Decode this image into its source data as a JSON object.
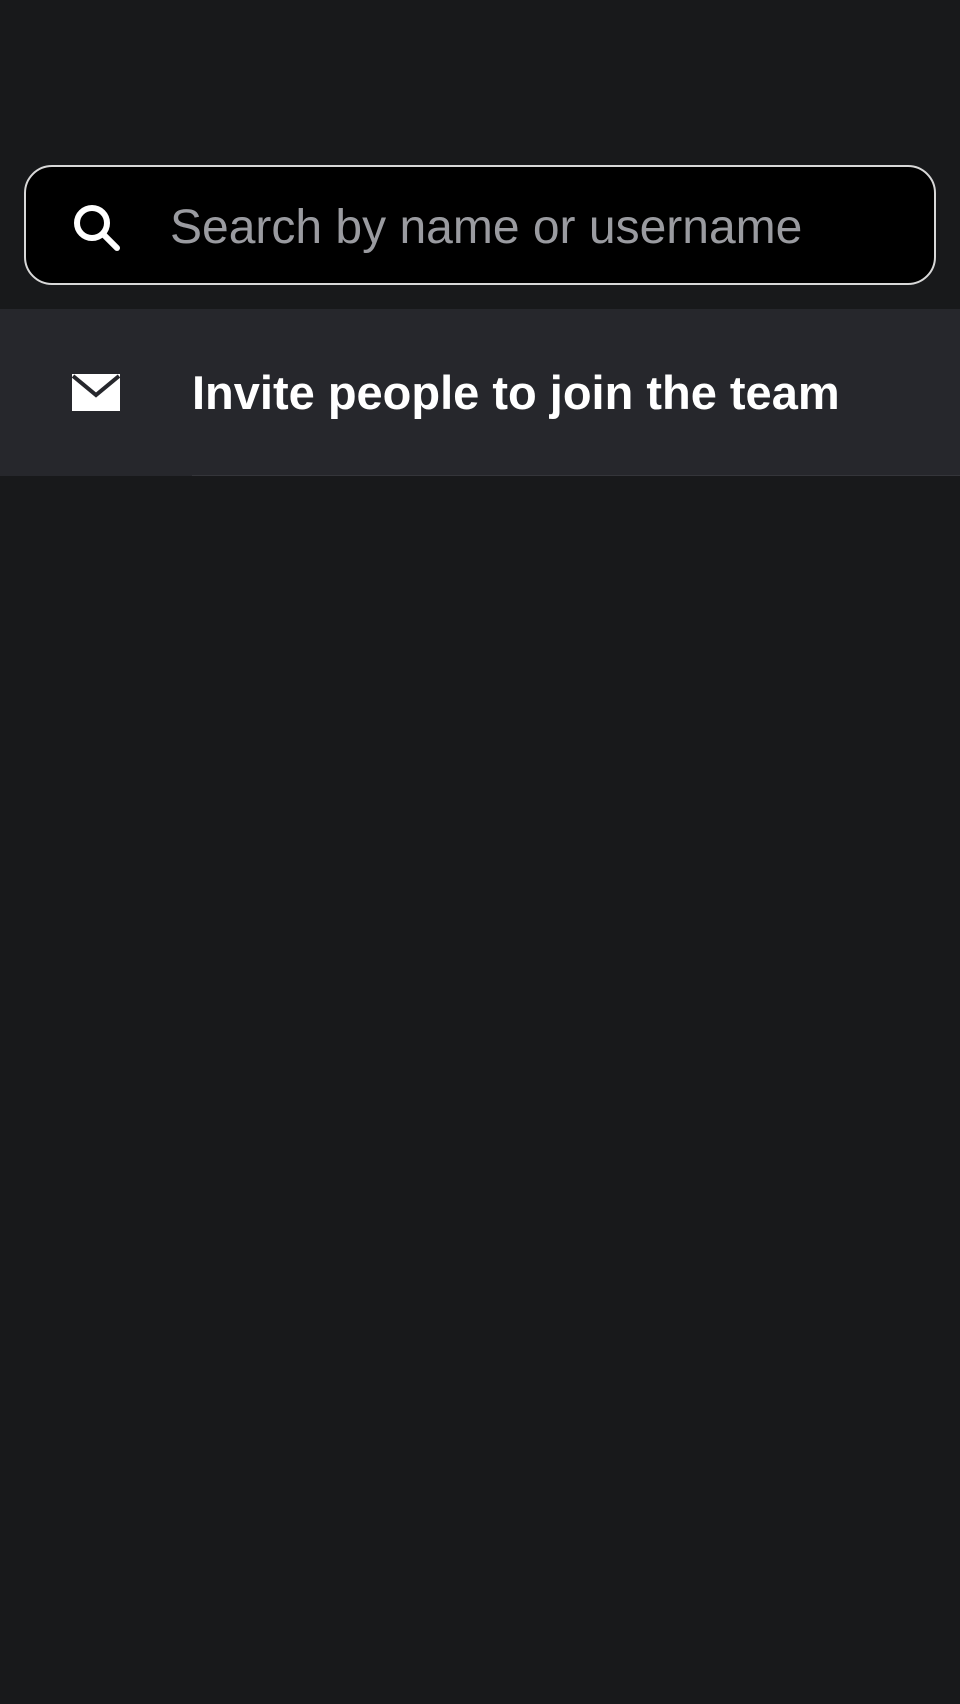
{
  "colors": {
    "background": "#18191b",
    "search_background": "#000000",
    "search_border": "#d8d8d8",
    "placeholder": "#9a9ba0",
    "row_background": "#26272c",
    "text_primary": "#ffffff"
  },
  "search": {
    "icon": "search-icon",
    "value": "",
    "placeholder": "Search by name or username"
  },
  "invite": {
    "icon": "envelope-icon",
    "label": "Invite people to join the team"
  }
}
